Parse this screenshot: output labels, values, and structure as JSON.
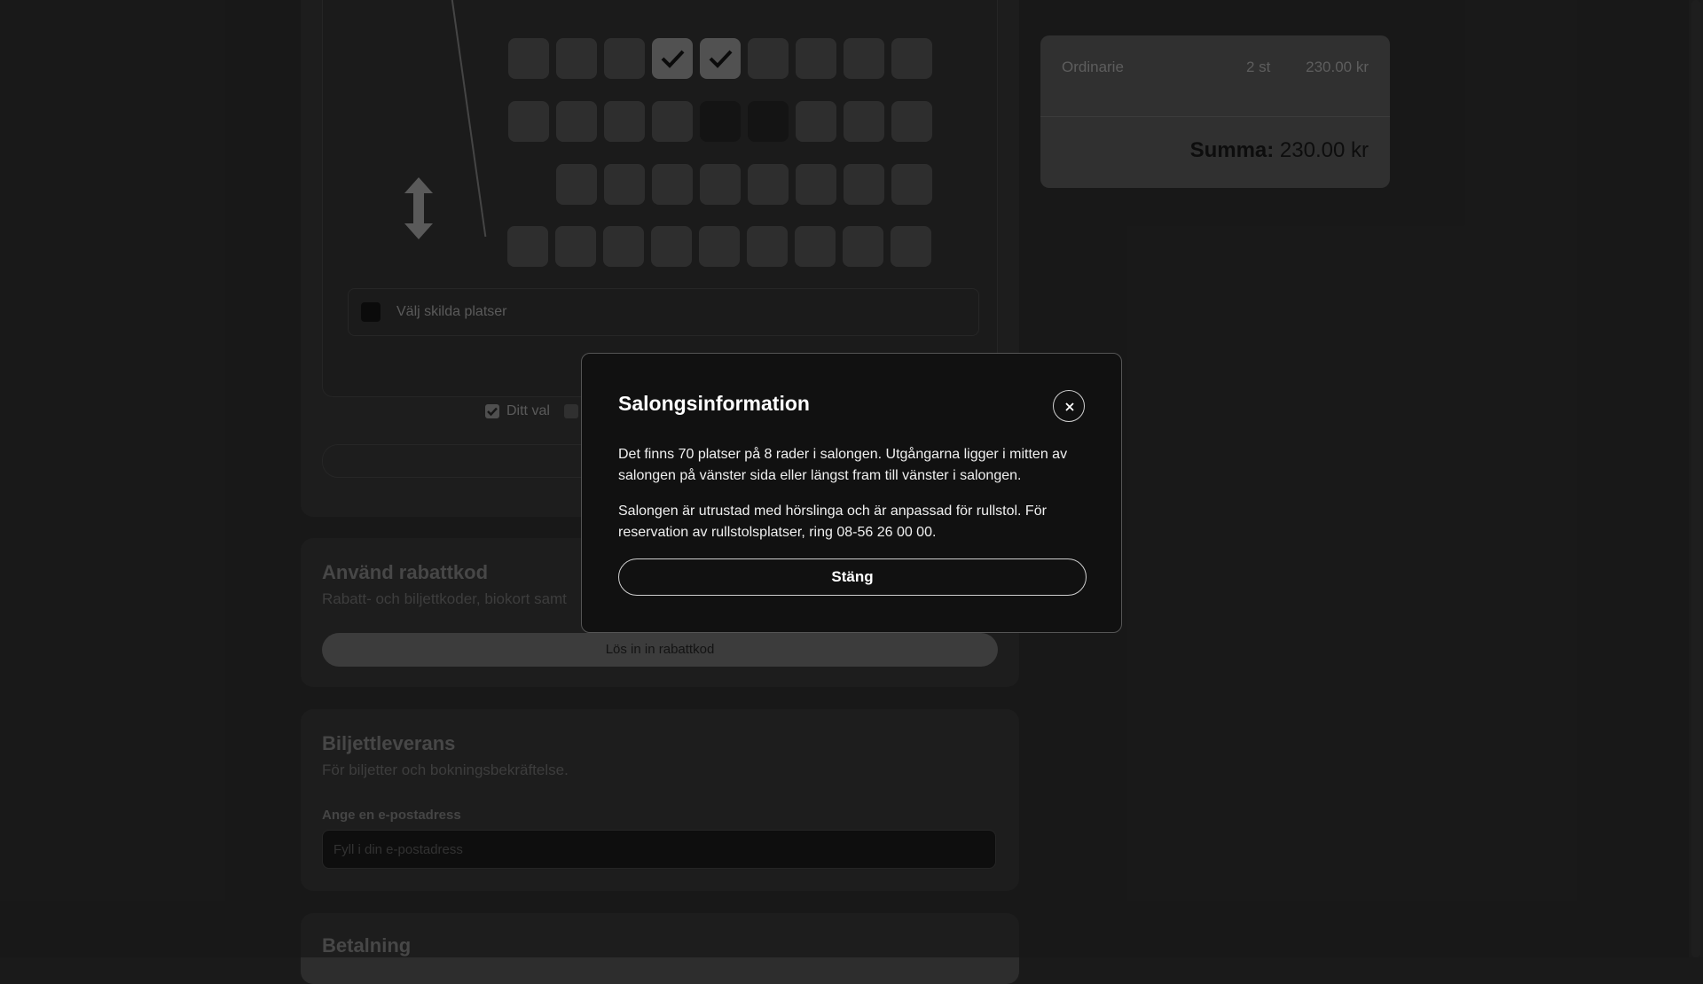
{
  "seat_map": {
    "rows": [
      {
        "seats": [
          "free",
          "free",
          "free",
          "mine",
          "mine",
          "free",
          "free",
          "free",
          "free"
        ]
      },
      {
        "seats": [
          "free",
          "free",
          "free",
          "free",
          "taken",
          "taken",
          "free",
          "free",
          "free"
        ]
      },
      {
        "seats": [
          null,
          "free",
          "free",
          "free",
          "free",
          "free",
          "free",
          "free",
          "free"
        ]
      },
      {
        "seats": [
          "free",
          "free",
          "free",
          "free",
          "free",
          "free",
          "free",
          "free",
          "free"
        ]
      }
    ],
    "split_seats_label": "Välj skilda platser",
    "legend_your_choice": "Ditt val"
  },
  "discount": {
    "title": "Använd rabattkod",
    "subtitle": "Rabatt- och biljettkoder, biokort samt",
    "button_label": "Lös in in rabattkod"
  },
  "delivery": {
    "title": "Biljettleverans",
    "subtitle": "För biljetter och bokningsbekräftelse.",
    "email_label": "Ange en e-postadress",
    "email_placeholder": "Fyll i din e-postadress",
    "email_value": ""
  },
  "payment": {
    "title": "Betalning"
  },
  "summary": {
    "ticket_type": "Ordinarie",
    "quantity": "2 st",
    "price": "230.00 kr",
    "total_label": "Summa:",
    "total_value": "230.00 kr"
  },
  "modal": {
    "title": "Salongsinformation",
    "paragraph1": "Det finns 70 platser på 8 rader i salongen. Utgångarna ligger i mitten av salongen på vänster sida eller längst fram till vänster i salongen.",
    "paragraph2": "Salongen är utrustad med hörslinga och är anpassad för rullstol. För reservation av rullstolsplatser, ring 08-56 26 00 00.",
    "close_button": "Stäng"
  },
  "colors": {
    "modal_bg": "#111111",
    "overlay": "rgba(0,0,0,0.35)",
    "seat_free": "#474747",
    "seat_mine": "#7d7d7d"
  }
}
